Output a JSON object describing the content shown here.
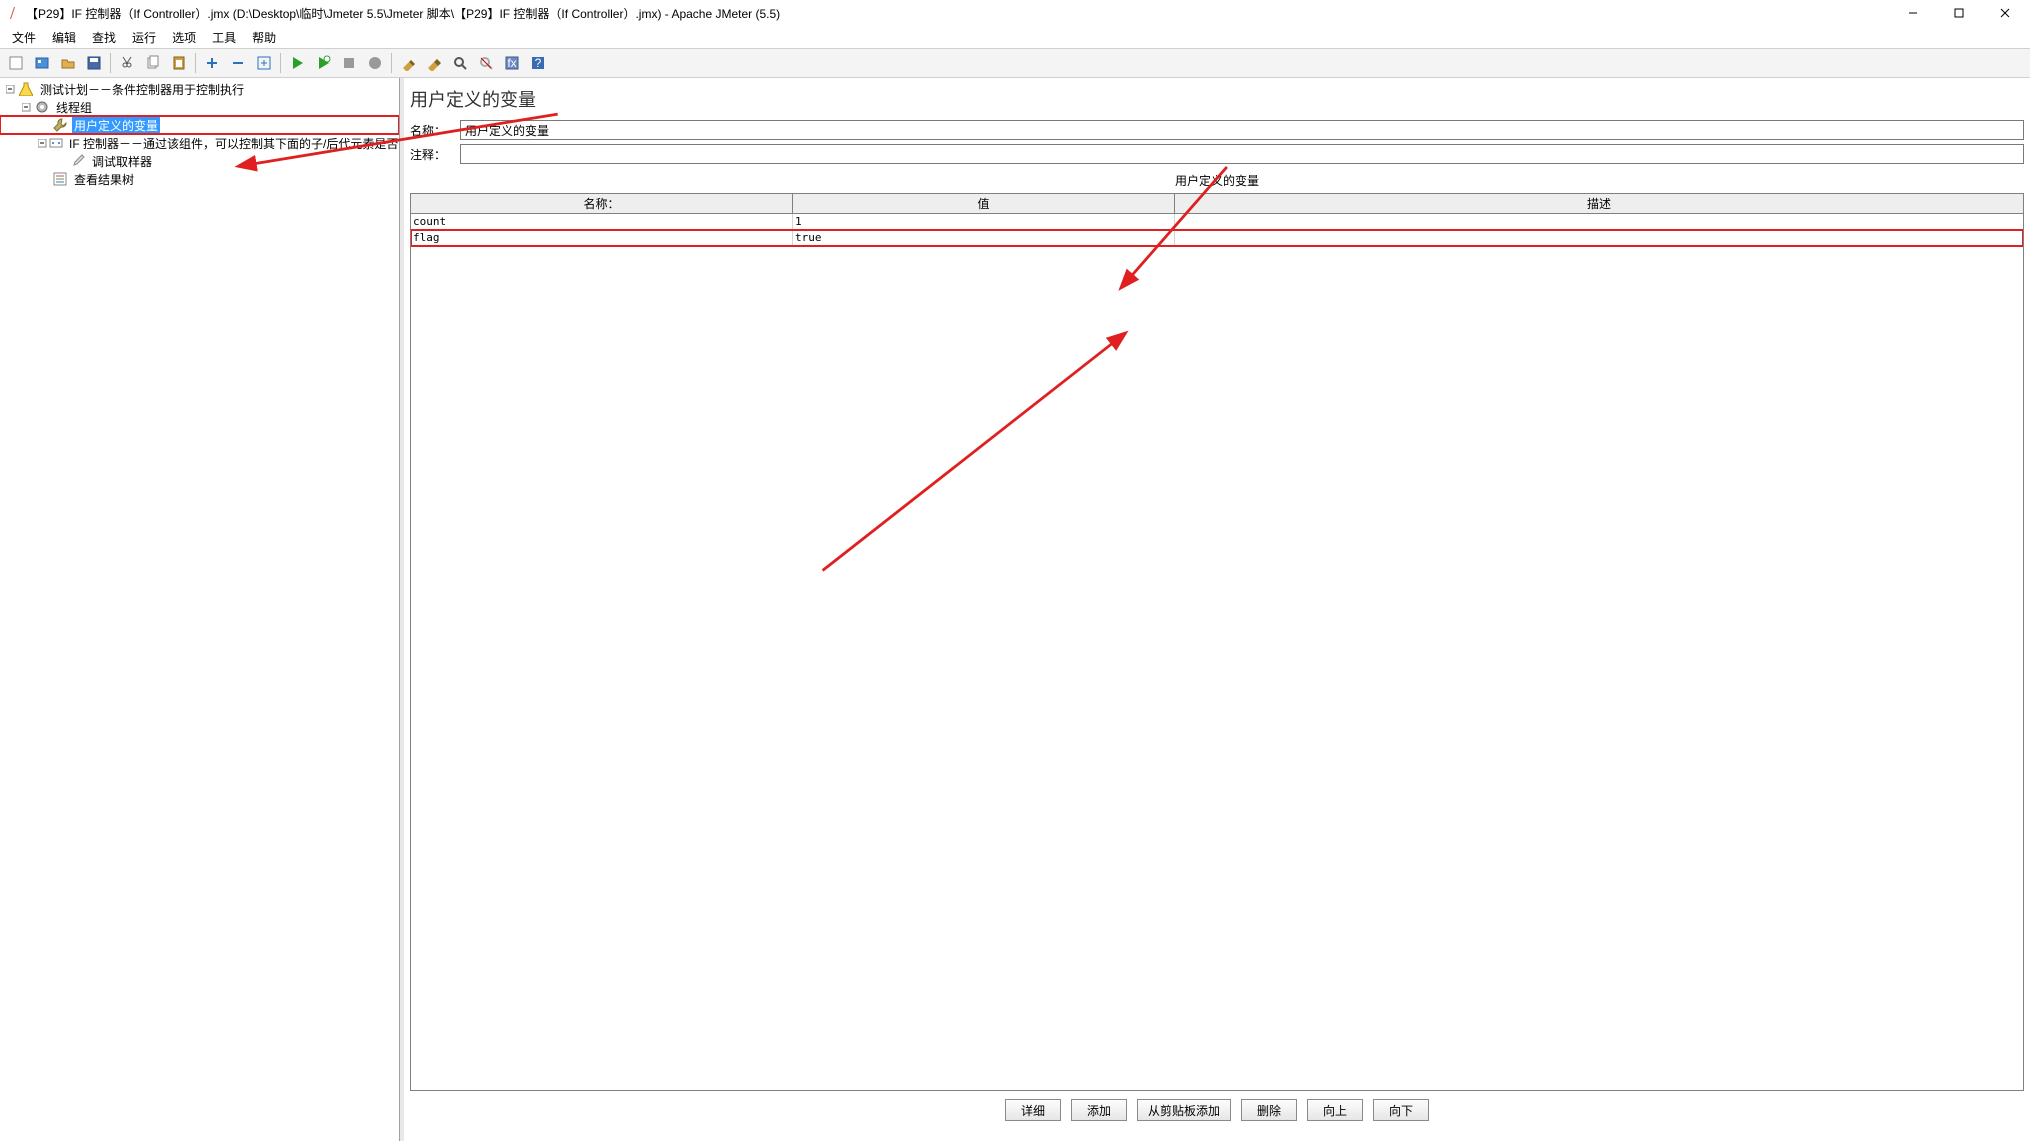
{
  "window": {
    "title": "【P29】IF 控制器（If Controller）.jmx (D:\\Desktop\\临时\\Jmeter 5.5\\Jmeter 脚本\\【P29】IF 控制器（If Controller）.jmx) - Apache JMeter (5.5)"
  },
  "menu": {
    "file": "文件",
    "edit": "编辑",
    "search": "查找",
    "run": "运行",
    "options": "选项",
    "tools": "工具",
    "help": "帮助"
  },
  "tree": {
    "test_plan": "测试计划－－条件控制器用于控制执行",
    "thread_group": "线程组",
    "user_vars": "用户定义的变量",
    "if_controller": "IF 控制器－－通过该组件，可以控制其下面的子/后代元素是否执行",
    "debug_sampler": "调试取样器",
    "view_results": "查看结果树"
  },
  "panel": {
    "title": "用户定义的变量",
    "name_label": "名称：",
    "name_value": "用户定义的变量",
    "comment_label": "注释：",
    "comment_value": "",
    "section": "用户定义的变量"
  },
  "table": {
    "col_name": "名称：",
    "col_value": "值",
    "col_desc": "描述",
    "rows": [
      {
        "name": "count",
        "value": "1",
        "desc": ""
      },
      {
        "name": "flag",
        "value": "true",
        "desc": ""
      }
    ]
  },
  "buttons": {
    "detail": "详细",
    "add": "添加",
    "from_clip": "从剪贴板添加",
    "delete": "删除",
    "up": "向上",
    "down": "向下"
  }
}
